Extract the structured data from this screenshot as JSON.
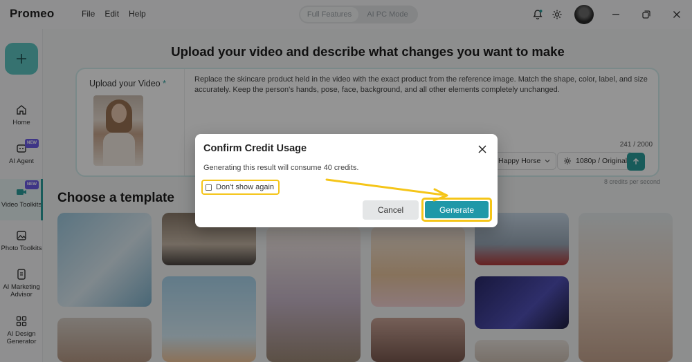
{
  "app": {
    "brand": "Promeo",
    "menu": [
      "File",
      "Edit",
      "Help"
    ],
    "mode_toggle": [
      "Full Features",
      "AI PC Mode"
    ]
  },
  "sidebar": {
    "items": [
      {
        "label": "Home",
        "icon": "home-icon",
        "badge": ""
      },
      {
        "label": "AI Agent",
        "icon": "agent-icon",
        "badge": "NEW"
      },
      {
        "label": "Video Toolkits",
        "icon": "video-icon",
        "badge": "NEW"
      },
      {
        "label": "Photo Toolkits",
        "icon": "photo-icon",
        "badge": ""
      },
      {
        "label": "AI Marketing Advisor",
        "icon": "advisor-icon",
        "badge": ""
      },
      {
        "label": "AI Design Generator",
        "icon": "design-grid-icon",
        "badge": ""
      }
    ]
  },
  "main": {
    "headline": "Upload your video and describe what changes you want to make",
    "upload_label": "Upload your Video",
    "required_mark": "*",
    "prompt": "Replace the skincare product held in the video with the exact product from the reference image. Match the shape, color, label, and size accurately. Keep the person's hands, pose, face, background, and all other elements completely unchanged.",
    "counter": "241 / 2000",
    "model_select": "Happy Horse",
    "quality_select": "1080p / Original",
    "credit_note": "8 credits per second",
    "templates_title": "Choose a template"
  },
  "modal": {
    "title": "Confirm Credit Usage",
    "body": "Generating this result will consume 40 credits.",
    "checkbox_label": "Don't show again",
    "cancel_label": "Cancel",
    "generate_label": "Generate"
  },
  "colors": {
    "accent": "#2a9d9b",
    "generate": "#1f98a8",
    "highlight": "#f5c518",
    "new_badge": "#6b5ce7"
  }
}
